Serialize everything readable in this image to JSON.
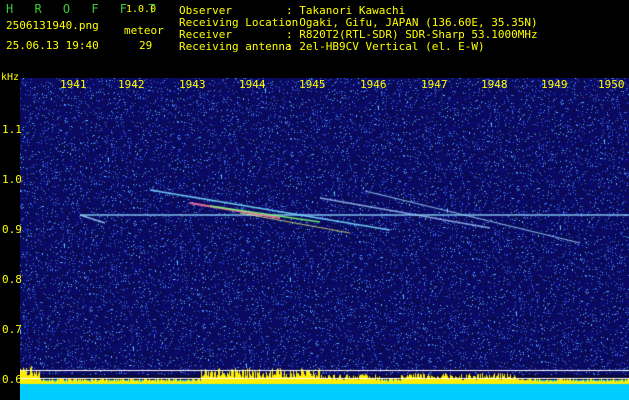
{
  "header": {
    "app_title": "H R O F F T",
    "version": "1.0.0",
    "filename": "2506131940.png",
    "datetime": "25.06.13 19:40",
    "meteor_label": "meteor",
    "meteor_count": "29",
    "observer_key": "Observer",
    "observer_val": ": Takanori Kawachi",
    "location_key": "Receiving Location",
    "location_val": ": Ogaki, Gifu, JAPAN (136.60E, 35.35N)",
    "receiver_key": "Receiver",
    "receiver_val": ": R820T2(RTL-SDR) SDR-Sharp 53.1000MHz",
    "antenna_key": "Receiving antenna",
    "antenna_val": ": 2el-HB9CV Vertical (el. E-W)"
  },
  "axis": {
    "y_unit": "kHz",
    "y_ticks": [
      "1.1",
      "1.0",
      "0.9",
      "0.8",
      "0.7",
      "0.6"
    ],
    "x_ticks": [
      "1941",
      "1942",
      "1943",
      "1944",
      "1945",
      "1946",
      "1947",
      "1948",
      "1949",
      "1950"
    ]
  },
  "colors": {
    "background": "#000000",
    "label_yellow": "#ffff00",
    "label_green": "#33cc33",
    "spectrum_bg": "#0a0a3a",
    "level_fill": "#ffee00",
    "baseline": "#00ccff"
  }
}
